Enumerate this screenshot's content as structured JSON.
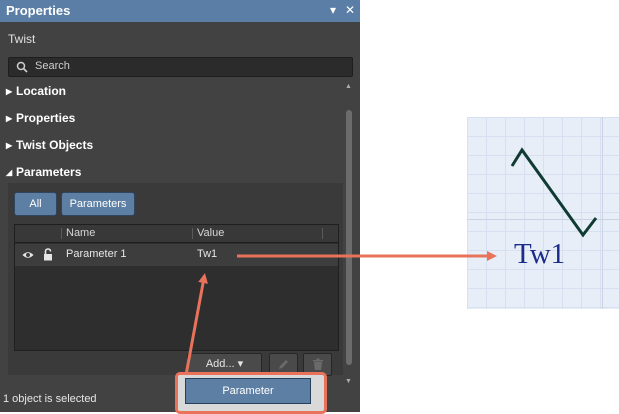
{
  "panel": {
    "title": "Properties",
    "pin_icon": "▾",
    "close_icon": "✕",
    "object_type": "Twist",
    "search_placeholder": "Search",
    "sections": {
      "location": "Location",
      "properties": "Properties",
      "twist_objects": "Twist Objects",
      "parameters": "Parameters"
    },
    "filters": {
      "all": "All",
      "parameters": "Parameters"
    },
    "table": {
      "columns": [
        "Name",
        "Value"
      ],
      "rows": [
        {
          "name": "Parameter 1",
          "value": "Tw1",
          "visible": true,
          "locked": true
        }
      ]
    },
    "add_button": "Add...",
    "add_dropdown_glyph": "▾",
    "status": "1 object is selected",
    "popup_item": "Parameter"
  },
  "schematic": {
    "label": "Tw1",
    "label_color": "#1a2b8a",
    "wire_color": "#0f3b33"
  },
  "colors": {
    "accent_blue": "#5d7fa3",
    "callout_orange": "#e8735a",
    "panel_bg": "#424242"
  }
}
